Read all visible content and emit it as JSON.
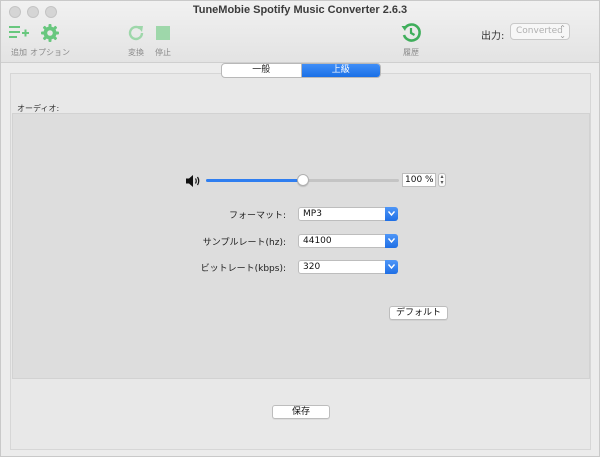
{
  "window": {
    "title": "TuneMobie Spotify Music Converter 2.6.3"
  },
  "toolbar": {
    "add_label": "追加",
    "options_label": "オプション",
    "convert_label": "変換",
    "stop_label": "停止",
    "history_label": "履歴",
    "output_label": "出力:",
    "output_value": "Converted"
  },
  "tabs": [
    {
      "label": "一般",
      "active": false
    },
    {
      "label": "上級",
      "active": true
    }
  ],
  "audio": {
    "section_label": "オーディオ:",
    "volume_value": 100,
    "volume_text": "100 %",
    "format_label": "フォーマット:",
    "format_value": "MP3",
    "sample_rate_label": "サンプルレート(hz):",
    "sample_rate_value": "44100",
    "bitrate_label": "ビットレート(kbps):",
    "bitrate_value": "320",
    "default_button": "デフォルト"
  },
  "footer": {
    "save_button": "保存"
  },
  "colors": {
    "accent": "#1a6fe6",
    "toolbar_icon": "#68c77e"
  }
}
